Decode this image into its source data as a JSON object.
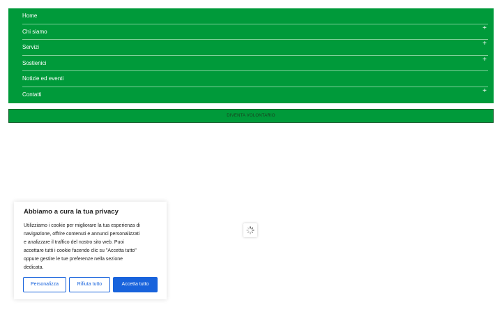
{
  "nav": {
    "items": [
      {
        "label": "Home",
        "has_submenu": false
      },
      {
        "label": "Chi siamo",
        "has_submenu": true
      },
      {
        "label": "Servizi",
        "has_submenu": true
      },
      {
        "label": "Sostienici",
        "has_submenu": true
      },
      {
        "label": "Notizie ed eventi",
        "has_submenu": false
      },
      {
        "label": "Contatti",
        "has_submenu": true
      }
    ],
    "expand_symbol": "+",
    "background_color": "#009a3a"
  },
  "volunteer_button": {
    "label": "DIVENTA VOLONTARIO"
  },
  "spinner": {
    "icon": "loading-spinner-icon"
  },
  "cookie_banner": {
    "title": "Abbiamo a cura la tua privacy",
    "text_lines": [
      "Utilizziamo i cookie per migliorare la tua esperienza di",
      "navigazione, offrire contenuti e annunci personalizzati",
      "e analizzare il traffico del nostro sito web. Puoi",
      "accettare tutti i cookie facendo clic su \"Accetta tutto\"",
      "oppure gestire le tue preferenze nella sezione",
      "dedicata."
    ],
    "buttons": {
      "customize": "Personalizza",
      "reject": "Rifiuta tutto",
      "accept": "Accetta tutto"
    },
    "accent_color": "#1863dc"
  }
}
